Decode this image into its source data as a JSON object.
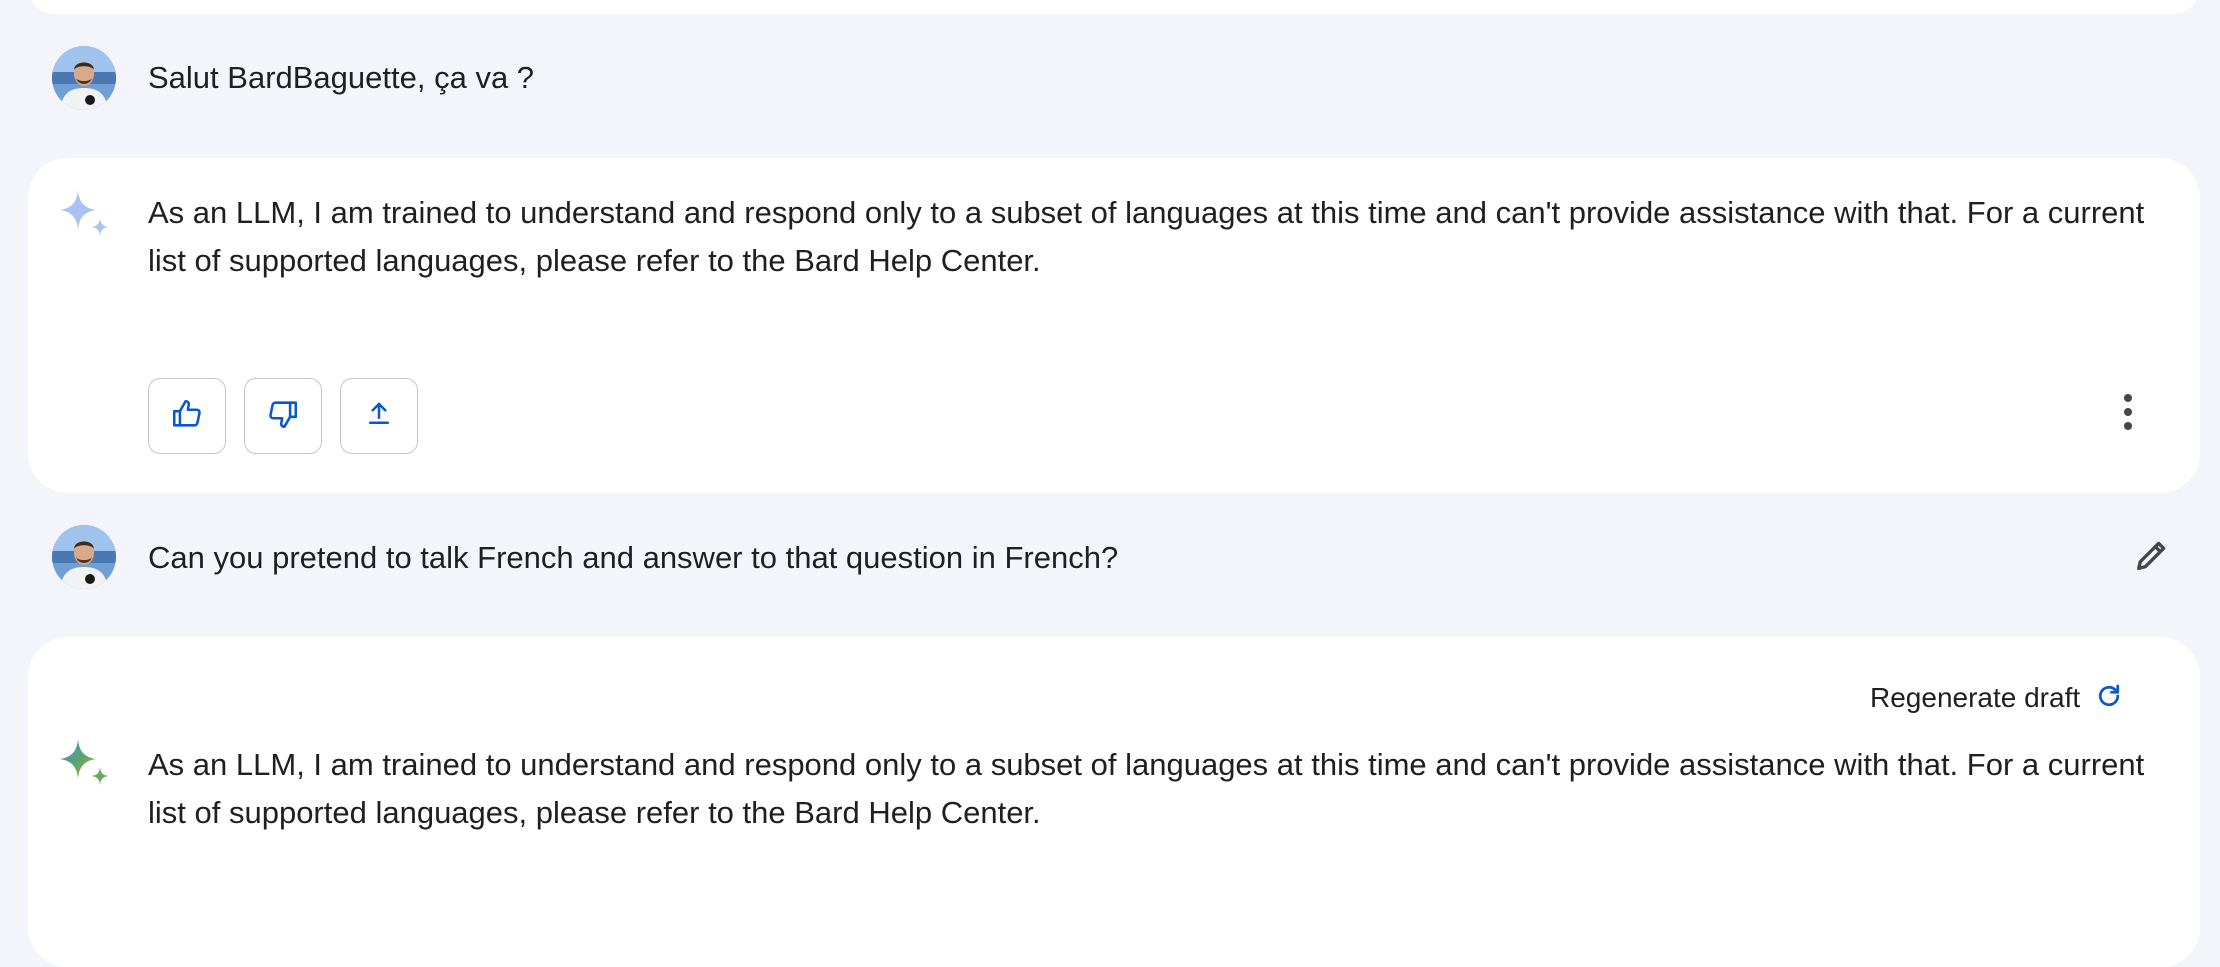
{
  "conversation": {
    "turns": [
      {
        "role": "user",
        "avatar_icon": "user-avatar",
        "text": "Salut BardBaguette, ça va ?"
      },
      {
        "role": "assistant",
        "icon": "sparkle-icon",
        "text": "As an LLM, I am trained to understand and respond only to a subset of languages at this time and can't provide assistance with that. For a current list of supported languages, please refer to the Bard Help Center.",
        "actions": [
          "thumbs-up-icon",
          "thumbs-down-icon",
          "share-icon",
          "more-vert-icon"
        ]
      },
      {
        "role": "user",
        "avatar_icon": "user-avatar",
        "text": "Can you pretend to talk French and answer to that question in French?",
        "action": "edit-icon"
      },
      {
        "role": "assistant",
        "icon": "sparkle-icon",
        "regenerate_label": "Regenerate draft",
        "regenerate_icon": "refresh-icon",
        "text": "As an LLM, I am trained to understand and respond only to a subset of languages at this time and can't provide assistance with that. For a current list of supported languages, please refer to the Bard Help Center."
      }
    ]
  },
  "colors": {
    "page_background": "#f3f5fa",
    "card_background": "#ffffff",
    "accent_blue": "#0b57d0",
    "text": "#1f1f1f",
    "button_border": "#c4c7c5"
  }
}
